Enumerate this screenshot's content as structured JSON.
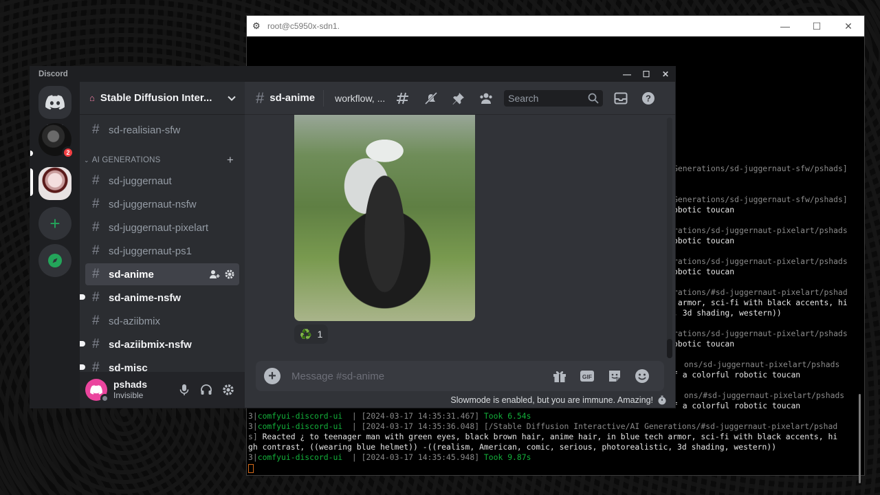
{
  "terminal": {
    "title": "root@c5950x-sdn1.",
    "lines": [
      {
        "text": "Generations/sd-juggernaut-sfw/pshads]",
        "cls": "t-gray"
      },
      {
        "text": "Generations/sd-juggernaut-sfw/pshads]",
        "cls": "t-gray"
      },
      {
        "text": "obotic toucan",
        "cls": "t-white"
      },
      {
        "text": "rations/sd-juggernaut-pixelart/pshads",
        "cls": "t-gray"
      },
      {
        "text": "obotic toucan",
        "cls": "t-white"
      },
      {
        "text": "rations/sd-juggernaut-pixelart/pshads",
        "cls": "t-gray"
      },
      {
        "text": "obotic toucan",
        "cls": "t-white"
      },
      {
        "text": "rations/#sd-juggernaut-pixelart/pshad",
        "cls": "t-gray"
      },
      {
        "text": " armor, sci-fi with black accents, hi",
        "cls": "t-white"
      },
      {
        "text": ", 3d shading, western))",
        "cls": "t-white"
      },
      {
        "text": "rations/sd-juggernaut-pixelart/pshads",
        "cls": "t-gray"
      },
      {
        "text": "obotic toucan",
        "cls": "t-white"
      },
      {
        "text": "ons/sd-juggernaut-pixelart/pshads",
        "cls": "t-gray"
      },
      {
        "text": "f a colorful robotic toucan",
        "cls": "t-white"
      },
      {
        "text": "ons/#sd-juggernaut-pixelart/pshads",
        "cls": "t-gray"
      },
      {
        "text": "f a colorful robotic toucan",
        "cls": "t-white"
      }
    ],
    "full_lines": [
      {
        "seg1": "3|",
        "seg2": "comfyui-discord-ui",
        "seg3": "  | [2024-03-17 14:35:31.467] ",
        "seg4": "Took 6.54s"
      },
      {
        "seg1": "3|",
        "seg2": "comfyui-discord-ui",
        "seg3": "  | [2024-03-17 14:35:36.048] [/Stable Diffusion Interactive/AI Generations/#sd-juggernaut-pixelart/pshad",
        "seg4": ""
      },
      {
        "seg1": "",
        "seg2": "",
        "seg3": "s] ",
        "seg4": "Reacted ¿ to teenager man with green eyes, black brown hair, anime hair, in blue tech armor, sci-fi with black accents, hi"
      },
      {
        "seg1": "",
        "seg2": "",
        "seg3": "",
        "seg4": "gh contrast, ((wearing blue helmet)) -((realism, American, comic, serious, photorealistic, 3d shading, western))"
      },
      {
        "seg1": "3|",
        "seg2": "comfyui-discord-ui",
        "seg3": "  | [2024-03-17 14:35:45.948] ",
        "seg4": "Took 9.87s"
      }
    ]
  },
  "discord": {
    "app_title": "Discord",
    "server_badge": "2",
    "guild_name": "Stable Diffusion Inter...",
    "channels_top": [
      {
        "name": "sd-realisian-sfw",
        "state": "normal"
      }
    ],
    "category": "AI GENERATIONS",
    "channels": [
      {
        "name": "sd-juggernaut",
        "state": "normal"
      },
      {
        "name": "sd-juggernaut-nsfw",
        "state": "normal"
      },
      {
        "name": "sd-juggernaut-pixelart",
        "state": "normal"
      },
      {
        "name": "sd-juggernaut-ps1",
        "state": "normal"
      },
      {
        "name": "sd-anime",
        "state": "active"
      },
      {
        "name": "sd-anime-nsfw",
        "state": "unread"
      },
      {
        "name": "sd-aziibmix",
        "state": "normal"
      },
      {
        "name": "sd-aziibmix-nsfw",
        "state": "unread"
      },
      {
        "name": "sd-misc",
        "state": "unread"
      }
    ],
    "user": {
      "name": "pshads",
      "status": "Invisible"
    },
    "channel_header": {
      "name": "sd-anime",
      "topic": "workflow, ...",
      "search_placeholder": "Search"
    },
    "reaction": {
      "emoji": "♻️",
      "count": "1"
    },
    "composer_placeholder": "Message #sd-anime",
    "slowmode_text": "Slowmode is enabled, but you are immune. Amazing!",
    "colors": {
      "blurple": "#5865f2",
      "green": "#23a55a",
      "pink": "#eb459e",
      "red": "#f23f43"
    }
  }
}
